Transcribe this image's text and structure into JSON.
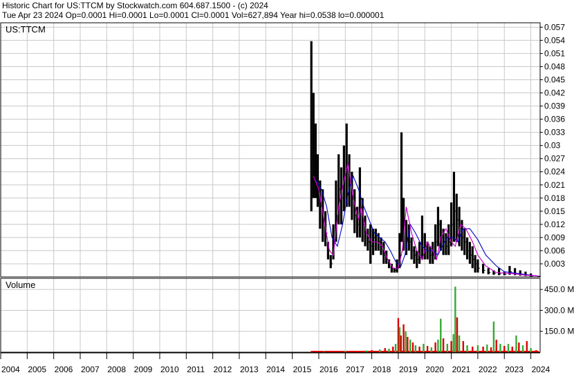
{
  "header": {
    "line1": "Historic Chart for US:TTCM by Stockwatch.com 604.687.1500 - (c) 2024",
    "line2": "Tue Apr 23 2024   Op=0.0001   Hi=0.0001   Lo=0.0001   Cl=0.0001   Vol=627,894   Year hi=0.0538   lo=0.000001"
  },
  "colors": {
    "price_bars": "#000000",
    "ma_short": "#cc00cc",
    "ma_long": "#0000cc",
    "volume_up": "#33aa33",
    "volume_down": "#dd0000",
    "grid": "#c8c8c8"
  },
  "chart_data": [
    {
      "type": "line",
      "title": "US:TTCM",
      "y_axis_side": "right",
      "yticks": [
        "0.057",
        "0.054",
        "0.051",
        "0.048",
        "0.045",
        "0.042",
        "0.039",
        "0.036",
        "0.033",
        "0.03",
        "0.027",
        "0.024",
        "0.021",
        "0.018",
        "0.015",
        "0.012",
        "0.009",
        "0.006",
        "0.003"
      ],
      "ylim": [
        0,
        0.058
      ],
      "xlim": [
        2004.0,
        2024.35
      ],
      "grid": true,
      "series": [
        {
          "kind": "price",
          "x": [
            2015.72,
            2015.8,
            2015.88,
            2015.96,
            2016.05,
            2016.15,
            2016.25,
            2016.35,
            2016.45,
            2016.55,
            2016.65,
            2016.75,
            2016.85,
            2016.95,
            2017.05,
            2017.15,
            2017.25,
            2017.35,
            2017.45,
            2017.55,
            2017.65,
            2017.75,
            2017.85,
            2017.95,
            2018.05,
            2018.15,
            2018.25,
            2018.35,
            2018.45,
            2018.55,
            2018.65,
            2018.75,
            2018.85,
            2018.95,
            2019.05,
            2019.12,
            2019.2,
            2019.3,
            2019.4,
            2019.5,
            2019.6,
            2019.7,
            2019.8,
            2019.9,
            2020.0,
            2020.1,
            2020.2,
            2020.3,
            2020.4,
            2020.5,
            2020.6,
            2020.7,
            2020.8,
            2020.9,
            2021.0,
            2021.1,
            2021.2,
            2021.3,
            2021.4,
            2021.5,
            2021.6,
            2021.7,
            2021.8,
            2021.9,
            2022.0,
            2022.2,
            2022.4,
            2022.6,
            2022.8,
            2023.0,
            2023.2,
            2023.4,
            2023.6,
            2023.8,
            2024.0,
            2024.3
          ],
          "high": [
            0.0538,
            0.042,
            0.035,
            0.028,
            0.022,
            0.02,
            0.015,
            0.008,
            0.005,
            0.012,
            0.022,
            0.028,
            0.025,
            0.03,
            0.035,
            0.028,
            0.024,
            0.02,
            0.016,
            0.025,
            0.018,
            0.014,
            0.011,
            0.012,
            0.011,
            0.011,
            0.01,
            0.009,
            0.008,
            0.006,
            0.004,
            0.003,
            0.002,
            0.004,
            0.01,
            0.033,
            0.018,
            0.013,
            0.012,
            0.009,
            0.007,
            0.006,
            0.008,
            0.014,
            0.01,
            0.008,
            0.007,
            0.008,
            0.012,
            0.016,
            0.013,
            0.011,
            0.01,
            0.012,
            0.017,
            0.024,
            0.019,
            0.016,
            0.013,
            0.011,
            0.009,
            0.008,
            0.007,
            0.005,
            0.004,
            0.003,
            0.002,
            0.0015,
            0.002,
            0.0012,
            0.0025,
            0.002,
            0.0015,
            0.0012,
            0.0008,
            0.0002
          ],
          "low": [
            0.015,
            0.018,
            0.018,
            0.016,
            0.011,
            0.008,
            0.007,
            0.004,
            0.002,
            0.004,
            0.008,
            0.012,
            0.012,
            0.015,
            0.016,
            0.016,
            0.013,
            0.01,
            0.009,
            0.009,
            0.008,
            0.007,
            0.006,
            0.003,
            0.005,
            0.006,
            0.006,
            0.005,
            0.003,
            0.003,
            0.002,
            0.001,
            0.001,
            0.001,
            0.002,
            0.008,
            0.006,
            0.005,
            0.006,
            0.004,
            0.003,
            0.002,
            0.003,
            0.004,
            0.004,
            0.004,
            0.003,
            0.003,
            0.004,
            0.007,
            0.006,
            0.005,
            0.005,
            0.005,
            0.007,
            0.008,
            0.008,
            0.007,
            0.006,
            0.005,
            0.004,
            0.003,
            0.002,
            0.001,
            0.001,
            0.0008,
            0.0006,
            0.0005,
            0.0004,
            0.0004,
            0.0005,
            0.0004,
            0.0003,
            0.0002,
            0.0001,
            5e-05
          ],
          "close": [
            0.022,
            0.028,
            0.024,
            0.02,
            0.016,
            0.013,
            0.01,
            0.006,
            0.003,
            0.008,
            0.014,
            0.02,
            0.018,
            0.024,
            0.026,
            0.022,
            0.018,
            0.014,
            0.012,
            0.016,
            0.012,
            0.01,
            0.008,
            0.007,
            0.009,
            0.008,
            0.008,
            0.007,
            0.005,
            0.004,
            0.003,
            0.002,
            0.0015,
            0.002,
            0.005,
            0.018,
            0.012,
            0.009,
            0.008,
            0.006,
            0.005,
            0.004,
            0.005,
            0.009,
            0.007,
            0.006,
            0.005,
            0.005,
            0.008,
            0.012,
            0.009,
            0.008,
            0.007,
            0.008,
            0.012,
            0.015,
            0.013,
            0.011,
            0.009,
            0.008,
            0.006,
            0.005,
            0.004,
            0.003,
            0.002,
            0.0015,
            0.001,
            0.0008,
            0.0007,
            0.0006,
            0.0012,
            0.0008,
            0.0006,
            0.0004,
            0.0002,
            0.0001
          ]
        },
        {
          "kind": "ma_short",
          "x": [
            2015.8,
            2016.0,
            2016.2,
            2016.4,
            2016.55,
            2016.75,
            2016.95,
            2017.1,
            2017.3,
            2017.5,
            2017.6,
            2017.8,
            2018.0,
            2018.2,
            2018.4,
            2018.6,
            2018.8,
            2019.0,
            2019.15,
            2019.3,
            2019.5,
            2019.7,
            2019.9,
            2020.1,
            2020.3,
            2020.45,
            2020.6,
            2020.8,
            2021.0,
            2021.15,
            2021.35,
            2021.55,
            2021.8,
            2022.0,
            2022.3,
            2022.7,
            2023.0,
            2023.4,
            2023.8,
            2024.3
          ],
          "y": [
            0.023,
            0.02,
            0.013,
            0.006,
            0.005,
            0.016,
            0.022,
            0.026,
            0.018,
            0.013,
            0.016,
            0.01,
            0.008,
            0.008,
            0.007,
            0.004,
            0.002,
            0.002,
            0.006,
            0.016,
            0.01,
            0.006,
            0.004,
            0.008,
            0.006,
            0.004,
            0.009,
            0.011,
            0.008,
            0.007,
            0.012,
            0.011,
            0.008,
            0.005,
            0.0025,
            0.001,
            0.0009,
            0.0007,
            0.0004,
            0.0002
          ]
        },
        {
          "kind": "ma_long",
          "x": [
            2015.9,
            2016.1,
            2016.3,
            2016.5,
            2016.7,
            2016.9,
            2017.1,
            2017.3,
            2017.5,
            2017.7,
            2017.9,
            2018.1,
            2018.3,
            2018.5,
            2018.7,
            2018.9,
            2019.1,
            2019.25,
            2019.45,
            2019.65,
            2019.9,
            2020.1,
            2020.3,
            2020.5,
            2020.65,
            2020.85,
            2021.05,
            2021.25,
            2021.45,
            2021.7,
            2022.0,
            2022.3,
            2022.7,
            2023.0,
            2023.5,
            2024.0,
            2024.3
          ],
          "y": [
            0.022,
            0.02,
            0.016,
            0.009,
            0.007,
            0.012,
            0.019,
            0.023,
            0.02,
            0.016,
            0.013,
            0.01,
            0.009,
            0.008,
            0.006,
            0.0035,
            0.0025,
            0.005,
            0.012,
            0.01,
            0.007,
            0.006,
            0.006,
            0.005,
            0.007,
            0.009,
            0.009,
            0.008,
            0.011,
            0.011,
            0.0085,
            0.005,
            0.0025,
            0.0012,
            0.0008,
            0.0004,
            0.0002
          ]
        }
      ]
    },
    {
      "type": "bar",
      "title": "Volume",
      "y_axis_side": "right",
      "yticks": [
        "450.0 M",
        "300.0 M",
        "150.0 M"
      ],
      "ylim": [
        0,
        530
      ],
      "xticks": [
        "2004",
        "2005",
        "2006",
        "2007",
        "2008",
        "2009",
        "2010",
        "2011",
        "2012",
        "2013",
        "2014",
        "2015",
        "2016",
        "2017",
        "2018",
        "2019",
        "2020",
        "2021",
        "2022",
        "2023",
        "2024"
      ],
      "grid": true,
      "bars": [
        {
          "x": 2015.8,
          "v": 5,
          "up": false
        },
        {
          "x": 2016.2,
          "v": 6,
          "up": true
        },
        {
          "x": 2016.6,
          "v": 8,
          "up": false
        },
        {
          "x": 2017.0,
          "v": 10,
          "up": true
        },
        {
          "x": 2017.4,
          "v": 8,
          "up": false
        },
        {
          "x": 2017.8,
          "v": 12,
          "up": true
        },
        {
          "x": 2018.0,
          "v": 15,
          "up": false
        },
        {
          "x": 2018.3,
          "v": 20,
          "up": true
        },
        {
          "x": 2018.5,
          "v": 30,
          "up": false
        },
        {
          "x": 2018.65,
          "v": 25,
          "up": true
        },
        {
          "x": 2018.8,
          "v": 40,
          "up": false
        },
        {
          "x": 2018.9,
          "v": 60,
          "up": true
        },
        {
          "x": 2019.0,
          "v": 245,
          "up": false
        },
        {
          "x": 2019.05,
          "v": 180,
          "up": true
        },
        {
          "x": 2019.1,
          "v": 120,
          "up": false
        },
        {
          "x": 2019.2,
          "v": 200,
          "up": false
        },
        {
          "x": 2019.28,
          "v": 150,
          "up": true
        },
        {
          "x": 2019.35,
          "v": 110,
          "up": false
        },
        {
          "x": 2019.45,
          "v": 90,
          "up": true
        },
        {
          "x": 2019.55,
          "v": 70,
          "up": false
        },
        {
          "x": 2019.65,
          "v": 50,
          "up": true
        },
        {
          "x": 2019.8,
          "v": 40,
          "up": false
        },
        {
          "x": 2019.95,
          "v": 60,
          "up": true
        },
        {
          "x": 2020.1,
          "v": 45,
          "up": false
        },
        {
          "x": 2020.25,
          "v": 35,
          "up": true
        },
        {
          "x": 2020.4,
          "v": 70,
          "up": false
        },
        {
          "x": 2020.5,
          "v": 90,
          "up": true
        },
        {
          "x": 2020.6,
          "v": 240,
          "up": true
        },
        {
          "x": 2020.7,
          "v": 100,
          "up": false
        },
        {
          "x": 2020.85,
          "v": 60,
          "up": true
        },
        {
          "x": 2021.0,
          "v": 80,
          "up": false
        },
        {
          "x": 2021.08,
          "v": 130,
          "up": true
        },
        {
          "x": 2021.15,
          "v": 470,
          "up": true
        },
        {
          "x": 2021.22,
          "v": 250,
          "up": false
        },
        {
          "x": 2021.3,
          "v": 120,
          "up": true
        },
        {
          "x": 2021.45,
          "v": 80,
          "up": false
        },
        {
          "x": 2021.6,
          "v": 50,
          "up": true
        },
        {
          "x": 2021.8,
          "v": 40,
          "up": false
        },
        {
          "x": 2022.0,
          "v": 50,
          "up": true
        },
        {
          "x": 2022.2,
          "v": 40,
          "up": false
        },
        {
          "x": 2022.35,
          "v": 55,
          "up": true
        },
        {
          "x": 2022.5,
          "v": 35,
          "up": false
        },
        {
          "x": 2022.6,
          "v": 220,
          "up": true
        },
        {
          "x": 2022.7,
          "v": 90,
          "up": false
        },
        {
          "x": 2022.85,
          "v": 60,
          "up": true
        },
        {
          "x": 2023.0,
          "v": 45,
          "up": false
        },
        {
          "x": 2023.15,
          "v": 60,
          "up": true
        },
        {
          "x": 2023.3,
          "v": 40,
          "up": false
        },
        {
          "x": 2023.45,
          "v": 120,
          "up": true
        },
        {
          "x": 2023.55,
          "v": 70,
          "up": false
        },
        {
          "x": 2023.7,
          "v": 50,
          "up": true
        },
        {
          "x": 2023.85,
          "v": 80,
          "up": false
        },
        {
          "x": 2024.0,
          "v": 30,
          "up": true
        },
        {
          "x": 2024.2,
          "v": 15,
          "up": false
        }
      ]
    }
  ]
}
